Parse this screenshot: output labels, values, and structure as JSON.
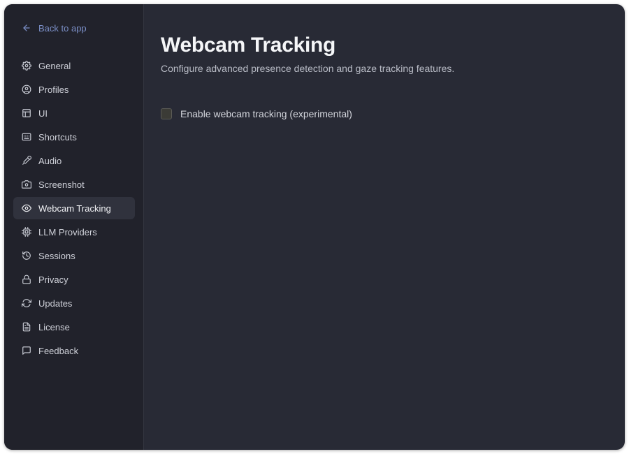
{
  "sidebar": {
    "back_label": "Back to app",
    "items": [
      {
        "label": "General",
        "icon": "gear-icon",
        "active": false
      },
      {
        "label": "Profiles",
        "icon": "user-circle-icon",
        "active": false
      },
      {
        "label": "UI",
        "icon": "layout-icon",
        "active": false
      },
      {
        "label": "Shortcuts",
        "icon": "keyboard-icon",
        "active": false
      },
      {
        "label": "Audio",
        "icon": "microphone-icon",
        "active": false
      },
      {
        "label": "Screenshot",
        "icon": "camera-icon",
        "active": false
      },
      {
        "label": "Webcam Tracking",
        "icon": "eye-icon",
        "active": true
      },
      {
        "label": "LLM Providers",
        "icon": "cpu-icon",
        "active": false
      },
      {
        "label": "Sessions",
        "icon": "history-icon",
        "active": false
      },
      {
        "label": "Privacy",
        "icon": "lock-icon",
        "active": false
      },
      {
        "label": "Updates",
        "icon": "refresh-icon",
        "active": false
      },
      {
        "label": "License",
        "icon": "file-text-icon",
        "active": false
      },
      {
        "label": "Feedback",
        "icon": "message-square-icon",
        "active": false
      }
    ]
  },
  "main": {
    "title": "Webcam Tracking",
    "subtitle": "Configure advanced presence detection and gaze tracking features.",
    "option": {
      "label": "Enable webcam tracking (experimental)",
      "checked": false
    }
  },
  "colors": {
    "window_bg": "#282a35",
    "sidebar_bg": "#21222b",
    "active_item_bg": "#30323d",
    "link": "#7b8fc7"
  }
}
